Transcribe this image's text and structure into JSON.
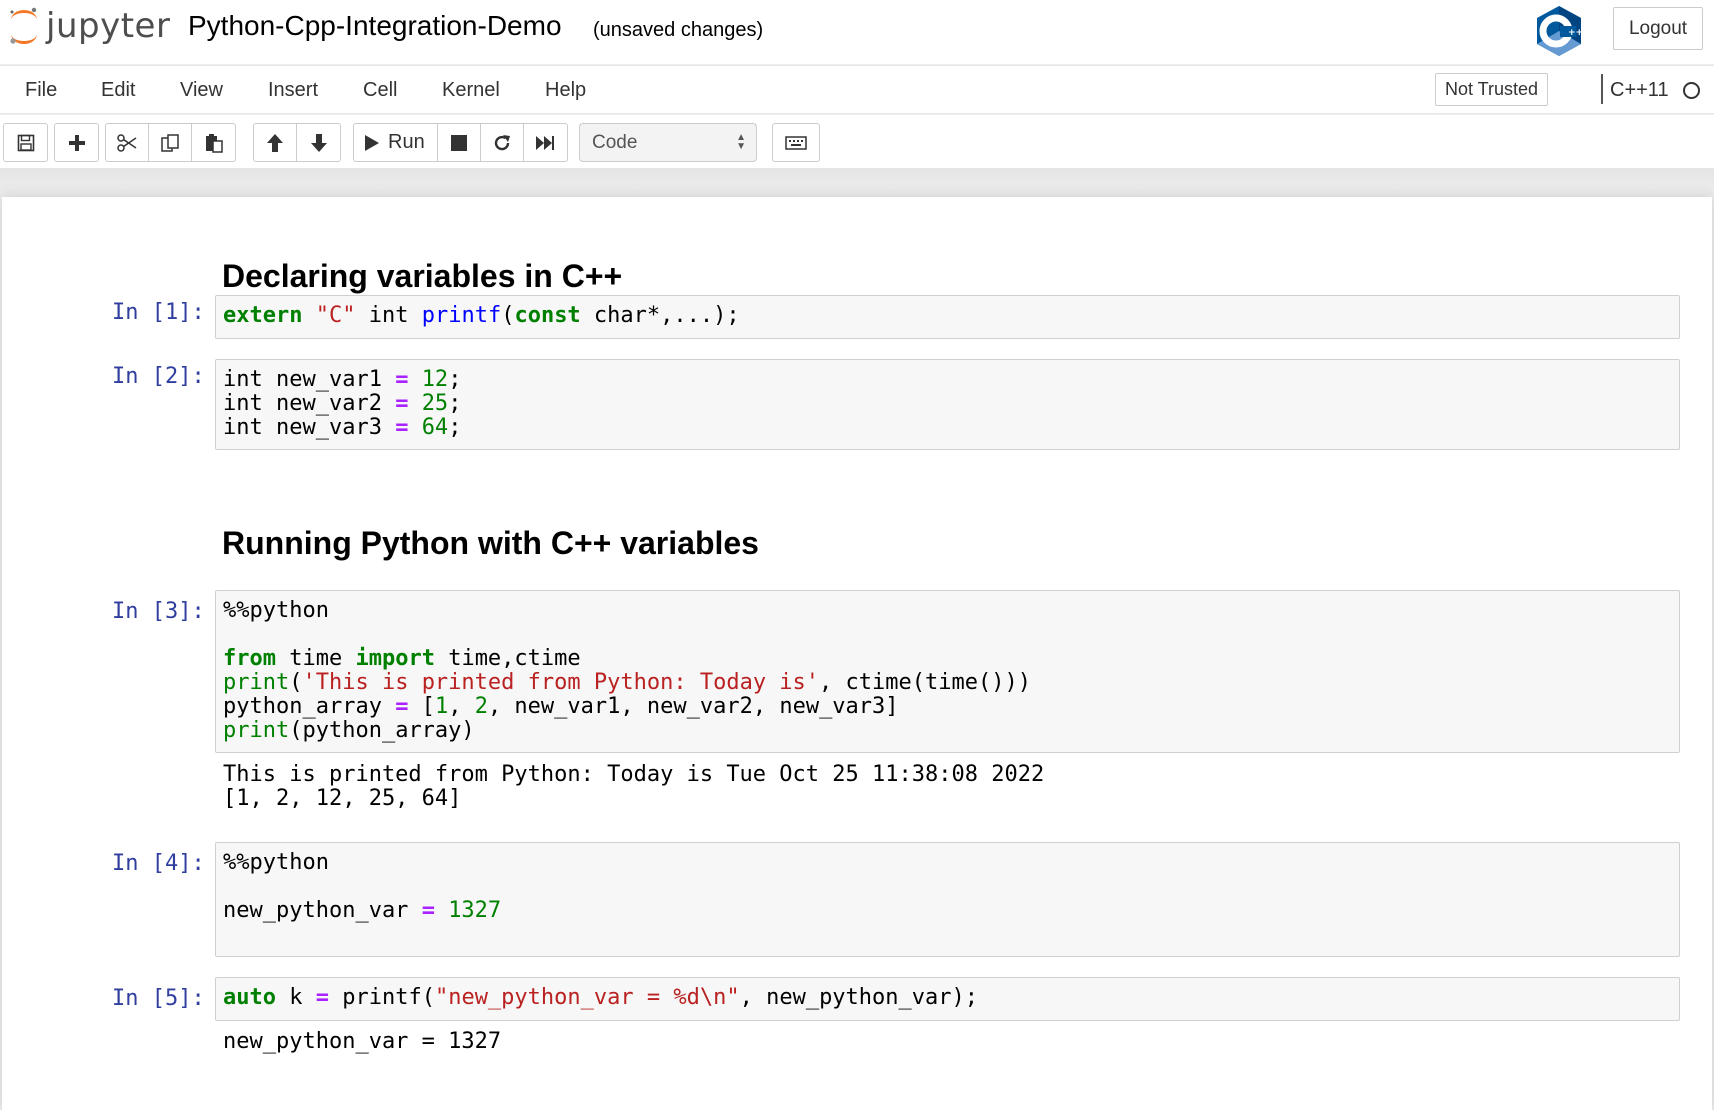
{
  "header": {
    "logo_text": "jupyter",
    "notebook_title": "Python-Cpp-Integration-Demo",
    "save_status": "(unsaved changes)",
    "kernel_logo_icon": "cpp-logo-icon",
    "logout_label": "Logout"
  },
  "menubar": {
    "items": [
      "File",
      "Edit",
      "View",
      "Insert",
      "Cell",
      "Kernel",
      "Help"
    ],
    "trust_label": "Not Trusted",
    "kernel_name": "C++11"
  },
  "toolbar": {
    "run_label": "Run",
    "cell_type": "Code",
    "icons": [
      "save-icon",
      "plus-icon",
      "scissors-icon",
      "copy-icon",
      "paste-icon",
      "arrow-up-icon",
      "arrow-down-icon",
      "play-icon",
      "stop-icon",
      "restart-icon",
      "fast-forward-icon",
      "keyboard-icon"
    ]
  },
  "cells": {
    "heading1": "Declaring variables in C++",
    "heading2": "Running Python with C++ variables",
    "cell1": {
      "prompt": "In [1]:",
      "t1": "extern",
      "t2": " ",
      "t3": "\"C\"",
      "t4": " int ",
      "t5": "printf",
      "t6": "(",
      "t7": "const",
      "t8": " char*,...);"
    },
    "cell2": {
      "prompt": "In [2]:",
      "l1a": "int new_var1 ",
      "l1b": "=",
      "l1c": " ",
      "l1d": "12",
      "l1e": ";",
      "l2a": "int new_var2 ",
      "l2b": "=",
      "l2c": " ",
      "l2d": "25",
      "l2e": ";",
      "l3a": "int new_var3 ",
      "l3b": "=",
      "l3c": " ",
      "l3d": "64",
      "l3e": ";"
    },
    "cell3": {
      "prompt": "In [3]:",
      "magic": "%%python",
      "l3a": "from",
      "l3b": " time ",
      "l3c": "import",
      "l3d": " time,ctime",
      "l4a": "print",
      "l4b": "(",
      "l4c": "'This is printed from Python: Today is'",
      "l4d": ", ctime(time()))",
      "l5a": "python_array ",
      "l5b": "=",
      "l5c": " [",
      "l5d": "1",
      "l5e": ", ",
      "l5f": "2",
      "l5g": ", new_var1, new_var2, new_var3]",
      "l6a": "print",
      "l6b": "(python_array)",
      "output1": "This is printed from Python: Today is Tue Oct 25 11:38:08 2022",
      "output2": "[1, 2, 12, 25, 64]"
    },
    "cell4": {
      "prompt": "In [4]:",
      "magic": "%%python",
      "l3a": "new_python_var ",
      "l3b": "=",
      "l3c": " ",
      "l3d": "1327"
    },
    "cell5": {
      "prompt": "In [5]:",
      "t1": "auto",
      "t2": " k ",
      "t3": "=",
      "t4": " printf(",
      "t5": "\"new_python_var = %d\\n\"",
      "t6": ", new_python_var);",
      "output": "new_python_var = 1327"
    }
  }
}
